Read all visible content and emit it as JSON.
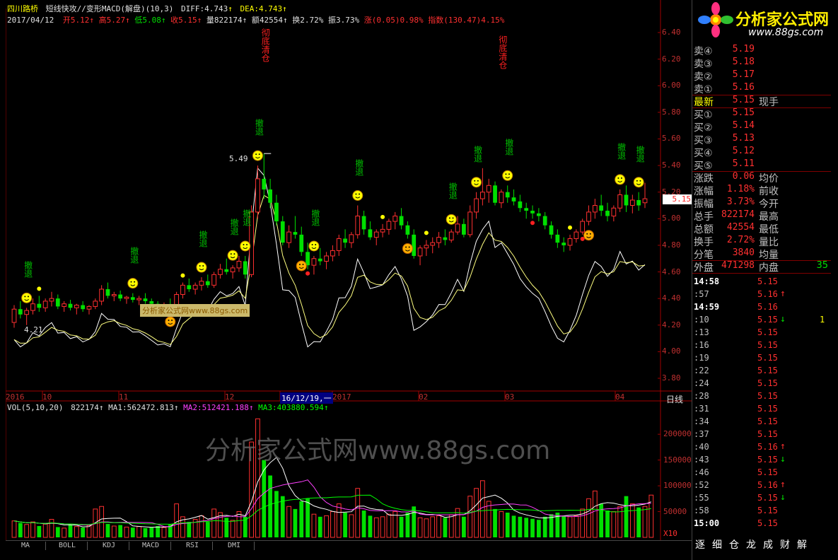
{
  "header": {
    "stock_name": "四川路桥",
    "indicator_title": "短线快攻//变形MACD(解盘)(10,3)",
    "diff_label": "DIFF:",
    "diff_value": "4.743",
    "dea_label": "DEA:",
    "dea_value": "4.743",
    "date": "2017/04/12",
    "open_label": "开",
    "open_value": "5.12",
    "high_label": "高",
    "high_value": "5.27",
    "low_label": "低",
    "low_value": "5.08",
    "close_label": "收",
    "close_value": "5.15",
    "volume_label": "量",
    "volume_value": "822174",
    "amount_label": "额",
    "amount_value": "42554",
    "turnover_label": "换",
    "turnover_value": "2.72%",
    "amplitude_label": "振",
    "amplitude_value": "3.73%",
    "change_label": "涨",
    "change_value": "(0.05)0.98%",
    "index_label": "指数",
    "index_value": "(130.47)4.15%"
  },
  "price_axis": {
    "ticks": [
      "6.40",
      "6.20",
      "6.00",
      "5.80",
      "5.60",
      "5.40",
      "5.20",
      "5.00",
      "4.80",
      "4.60",
      "4.40",
      "4.20",
      "4.00",
      "3.80"
    ],
    "current_price_tag": "5.15",
    "max_label": "5.49",
    "min_label": "4.21"
  },
  "time_axis": {
    "labels": [
      "2016",
      "10",
      "11",
      "12",
      "16/12/19,一",
      "2017",
      "02",
      "03",
      "04"
    ],
    "period_label": "日线"
  },
  "signals": {
    "green_label": "撤退",
    "red_label": "彻底清仓"
  },
  "volume_panel": {
    "header_prefix": "VOL(5,10,20)",
    "header_value": "822174",
    "ma1_label": "MA1:",
    "ma1_value": "562472.813",
    "ma2_label": "MA2:",
    "ma2_value": "512421.188",
    "ma3_label": "MA3:",
    "ma3_value": "403880.594",
    "ticks": [
      "200000",
      "150000",
      "100000",
      "50000"
    ],
    "unit_label": "X10"
  },
  "watermark": {
    "big": "分析家公式网www.88gs.com",
    "small": "分析家公式网www.88gs.com"
  },
  "logo": {
    "title": "分析家公式网",
    "url": "www.88gs.com"
  },
  "bottom_tabs": [
    "MA",
    "BOLL",
    "KDJ",
    "MACD",
    "RSI",
    "DMI"
  ],
  "right_tabs": [
    "逐",
    "细",
    "仓",
    "龙",
    "成",
    "财",
    "解"
  ],
  "quotes": {
    "sell": [
      {
        "label": "卖④",
        "value": "5.19"
      },
      {
        "label": "卖③",
        "value": "5.18"
      },
      {
        "label": "卖②",
        "value": "5.17"
      },
      {
        "label": "卖①",
        "value": "5.16"
      }
    ],
    "latest": {
      "label": "最新",
      "value": "5.15",
      "label2": "现手"
    },
    "buy": [
      {
        "label": "买①",
        "value": "5.15"
      },
      {
        "label": "买②",
        "value": "5.14"
      },
      {
        "label": "买③",
        "value": "5.13"
      },
      {
        "label": "买④",
        "value": "5.12"
      },
      {
        "label": "买⑤",
        "value": "5.11"
      }
    ],
    "stats": [
      {
        "label": "涨跌",
        "value": "0.06",
        "label2": "均价",
        "value2": ""
      },
      {
        "label": "涨幅",
        "value": "1.18%",
        "label2": "前收",
        "value2": ""
      },
      {
        "label": "振幅",
        "value": "3.73%",
        "label2": "今开",
        "value2": ""
      },
      {
        "label": "总手",
        "value": "822174",
        "label2": "最高",
        "value2": ""
      },
      {
        "label": "总额",
        "value": "42554",
        "label2": "最低",
        "value2": ""
      },
      {
        "label": "换手",
        "value": "2.72%",
        "label2": "量比",
        "value2": ""
      },
      {
        "label": "分笔",
        "value": "3840",
        "label2": "均量",
        "value2": ""
      }
    ],
    "outer": {
      "label": "外盘",
      "value": "471298",
      "label2": "内盘",
      "value2": "35"
    }
  },
  "ticks": [
    {
      "time": "14:58",
      "price": "5.15",
      "dir": "",
      "vol": ""
    },
    {
      "time": ":57",
      "price": "5.16",
      "dir": "up",
      "vol": ""
    },
    {
      "time": "14:59",
      "price": "5.16",
      "dir": "",
      "vol": ""
    },
    {
      "time": ":10",
      "price": "5.15",
      "dir": "down",
      "vol": "1"
    },
    {
      "time": ":13",
      "price": "5.15",
      "dir": "",
      "vol": ""
    },
    {
      "time": ":16",
      "price": "5.15",
      "dir": "",
      "vol": ""
    },
    {
      "time": ":19",
      "price": "5.15",
      "dir": "",
      "vol": ""
    },
    {
      "time": ":22",
      "price": "5.15",
      "dir": "",
      "vol": ""
    },
    {
      "time": ":24",
      "price": "5.15",
      "dir": "",
      "vol": ""
    },
    {
      "time": ":28",
      "price": "5.15",
      "dir": "",
      "vol": ""
    },
    {
      "time": ":31",
      "price": "5.15",
      "dir": "",
      "vol": ""
    },
    {
      "time": ":34",
      "price": "5.15",
      "dir": "",
      "vol": ""
    },
    {
      "time": ":37",
      "price": "5.15",
      "dir": "",
      "vol": ""
    },
    {
      "time": ":40",
      "price": "5.16",
      "dir": "up",
      "vol": ""
    },
    {
      "time": ":43",
      "price": "5.15",
      "dir": "down",
      "vol": ""
    },
    {
      "time": ":46",
      "price": "5.15",
      "dir": "",
      "vol": ""
    },
    {
      "time": ":52",
      "price": "5.16",
      "dir": "up",
      "vol": ""
    },
    {
      "time": ":55",
      "price": "5.15",
      "dir": "down",
      "vol": ""
    },
    {
      "time": ":58",
      "price": "5.15",
      "dir": "",
      "vol": ""
    },
    {
      "time": "15:00",
      "price": "5.15",
      "dir": "",
      "vol": ""
    }
  ],
  "chart_data": {
    "type": "candlestick",
    "period": "daily",
    "ylim": [
      3.75,
      6.45
    ],
    "volume_ylim": [
      0,
      240000
    ],
    "candles": [
      [
        4.22,
        4.35,
        4.18,
        4.32
      ],
      [
        4.32,
        4.38,
        4.25,
        4.28
      ],
      [
        4.28,
        4.33,
        4.2,
        4.31
      ],
      [
        4.31,
        4.4,
        4.28,
        4.36
      ],
      [
        4.36,
        4.42,
        4.3,
        4.33
      ],
      [
        4.33,
        4.4,
        4.3,
        4.38
      ],
      [
        4.38,
        4.45,
        4.34,
        4.4
      ],
      [
        4.4,
        4.43,
        4.32,
        4.34
      ],
      [
        4.34,
        4.38,
        4.3,
        4.36
      ],
      [
        4.36,
        4.39,
        4.31,
        4.33
      ],
      [
        4.33,
        4.36,
        4.28,
        4.35
      ],
      [
        4.35,
        4.38,
        4.3,
        4.32
      ],
      [
        4.32,
        4.35,
        4.28,
        4.34
      ],
      [
        4.34,
        4.4,
        4.32,
        4.38
      ],
      [
        4.38,
        4.5,
        4.35,
        4.47
      ],
      [
        4.47,
        4.52,
        4.4,
        4.42
      ],
      [
        4.42,
        4.45,
        4.38,
        4.43
      ],
      [
        4.43,
        4.46,
        4.38,
        4.4
      ],
      [
        4.4,
        4.42,
        4.36,
        4.41
      ],
      [
        4.41,
        4.44,
        4.37,
        4.39
      ],
      [
        4.39,
        4.42,
        4.35,
        4.4
      ],
      [
        4.4,
        4.44,
        4.36,
        4.38
      ],
      [
        4.38,
        4.4,
        4.33,
        4.36
      ],
      [
        4.36,
        4.38,
        4.3,
        4.34
      ],
      [
        4.34,
        4.37,
        4.28,
        4.35
      ],
      [
        4.35,
        4.4,
        4.3,
        4.33
      ],
      [
        4.33,
        4.45,
        4.3,
        4.43
      ],
      [
        4.43,
        4.52,
        4.4,
        4.5
      ],
      [
        4.5,
        4.55,
        4.45,
        4.47
      ],
      [
        4.47,
        4.52,
        4.43,
        4.5
      ],
      [
        4.5,
        4.56,
        4.46,
        4.53
      ],
      [
        4.53,
        4.58,
        4.48,
        4.5
      ],
      [
        4.5,
        4.6,
        4.48,
        4.58
      ],
      [
        4.58,
        4.66,
        4.55,
        4.62
      ],
      [
        4.62,
        4.7,
        4.58,
        4.6
      ],
      [
        4.6,
        4.65,
        4.55,
        4.63
      ],
      [
        4.63,
        4.72,
        4.6,
        4.68
      ],
      [
        4.68,
        4.72,
        4.55,
        4.58
      ],
      [
        4.58,
        5.1,
        4.56,
        5.05
      ],
      [
        5.05,
        5.4,
        5.0,
        5.3
      ],
      [
        5.3,
        5.49,
        5.15,
        5.22
      ],
      [
        5.22,
        5.3,
        5.08,
        5.12
      ],
      [
        5.12,
        5.18,
        4.95,
        4.98
      ],
      [
        4.98,
        5.02,
        4.8,
        4.82
      ],
      [
        4.82,
        4.95,
        4.78,
        4.9
      ],
      [
        4.9,
        5.02,
        4.85,
        4.88
      ],
      [
        4.88,
        4.94,
        4.72,
        4.75
      ],
      [
        4.75,
        4.82,
        4.62,
        4.65
      ],
      [
        4.65,
        4.72,
        4.58,
        4.7
      ],
      [
        4.7,
        4.78,
        4.65,
        4.68
      ],
      [
        4.68,
        4.75,
        4.62,
        4.72
      ],
      [
        4.72,
        4.8,
        4.68,
        4.76
      ],
      [
        4.76,
        4.88,
        4.72,
        4.85
      ],
      [
        4.85,
        4.92,
        4.78,
        4.82
      ],
      [
        4.82,
        4.9,
        4.78,
        4.88
      ],
      [
        4.88,
        5.1,
        4.85,
        5.02
      ],
      [
        5.02,
        5.06,
        4.88,
        4.92
      ],
      [
        4.92,
        4.98,
        4.84,
        4.86
      ],
      [
        4.86,
        4.92,
        4.8,
        4.9
      ],
      [
        4.9,
        4.96,
        4.86,
        4.92
      ],
      [
        4.92,
        5.0,
        4.88,
        4.98
      ],
      [
        4.98,
        5.05,
        4.92,
        5.02
      ],
      [
        5.02,
        5.08,
        4.92,
        4.95
      ],
      [
        4.95,
        4.98,
        4.85,
        4.88
      ],
      [
        4.88,
        4.92,
        4.7,
        4.72
      ],
      [
        4.72,
        4.8,
        4.65,
        4.78
      ],
      [
        4.78,
        4.84,
        4.72,
        4.8
      ],
      [
        4.8,
        4.86,
        4.74,
        4.82
      ],
      [
        4.82,
        4.9,
        4.78,
        4.86
      ],
      [
        4.86,
        4.92,
        4.8,
        4.84
      ],
      [
        4.84,
        4.92,
        4.82,
        4.9
      ],
      [
        4.9,
        5.02,
        4.88,
        4.96
      ],
      [
        4.96,
        5.0,
        4.86,
        4.88
      ],
      [
        4.88,
        5.1,
        4.86,
        5.05
      ],
      [
        5.05,
        5.2,
        5.0,
        5.15
      ],
      [
        5.15,
        5.38,
        5.1,
        5.2
      ],
      [
        5.2,
        5.3,
        5.12,
        5.25
      ],
      [
        5.25,
        5.28,
        5.1,
        5.12
      ],
      [
        5.12,
        5.22,
        5.08,
        5.2
      ],
      [
        5.2,
        5.25,
        5.12,
        5.16
      ],
      [
        5.16,
        5.22,
        5.1,
        5.13
      ],
      [
        5.13,
        5.18,
        5.05,
        5.08
      ],
      [
        5.08,
        5.12,
        5.0,
        5.06
      ],
      [
        5.06,
        5.1,
        5.0,
        5.04
      ],
      [
        5.04,
        5.08,
        4.98,
        5.02
      ],
      [
        5.02,
        5.05,
        4.92,
        4.95
      ],
      [
        4.95,
        4.98,
        4.85,
        4.88
      ],
      [
        4.88,
        4.92,
        4.78,
        4.82
      ],
      [
        4.82,
        4.86,
        4.75,
        4.8
      ],
      [
        4.8,
        4.88,
        4.76,
        4.85
      ],
      [
        4.85,
        4.92,
        4.82,
        4.9
      ],
      [
        4.9,
        5.0,
        4.88,
        4.98
      ],
      [
        4.98,
        5.1,
        4.95,
        5.05
      ],
      [
        5.05,
        5.15,
        5.0,
        5.1
      ],
      [
        5.1,
        5.18,
        5.02,
        5.06
      ],
      [
        5.06,
        5.12,
        4.98,
        5.02
      ],
      [
        5.02,
        5.1,
        4.98,
        5.08
      ],
      [
        5.08,
        5.22,
        5.05,
        5.18
      ],
      [
        5.18,
        5.25,
        5.05,
        5.1
      ],
      [
        5.1,
        5.18,
        5.04,
        5.14
      ],
      [
        5.14,
        5.2,
        5.06,
        5.1
      ],
      [
        5.12,
        5.27,
        5.08,
        5.15
      ]
    ],
    "volumes": [
      32000,
      28000,
      25000,
      30000,
      22000,
      26000,
      35000,
      20000,
      18000,
      24000,
      21000,
      19000,
      23000,
      55000,
      60000,
      26000,
      22000,
      24000,
      20000,
      19000,
      21000,
      18000,
      20000,
      22000,
      19000,
      25000,
      65000,
      40000,
      30000,
      35000,
      42000,
      30000,
      55000,
      48000,
      38000,
      33000,
      50000,
      40000,
      185000,
      230000,
      150000,
      120000,
      90000,
      80000,
      60000,
      55000,
      70000,
      75000,
      45000,
      40000,
      42000,
      50000,
      65000,
      48000,
      44000,
      95000,
      52000,
      42000,
      38000,
      40000,
      45000,
      50000,
      40000,
      48000,
      60000,
      38000,
      36000,
      40000,
      42000,
      38000,
      44000,
      56000,
      40000,
      80000,
      95000,
      110000,
      70000,
      55000,
      50000,
      48000,
      42000,
      40000,
      38000,
      36000,
      34000,
      40000,
      45000,
      48000,
      42000,
      40000,
      42000,
      55000,
      75000,
      90000,
      65000,
      52000,
      50000,
      60000,
      80000,
      65000,
      58000,
      60000,
      82000
    ],
    "title": "短线快攻//变形MACD(解盘)(10,3)"
  }
}
